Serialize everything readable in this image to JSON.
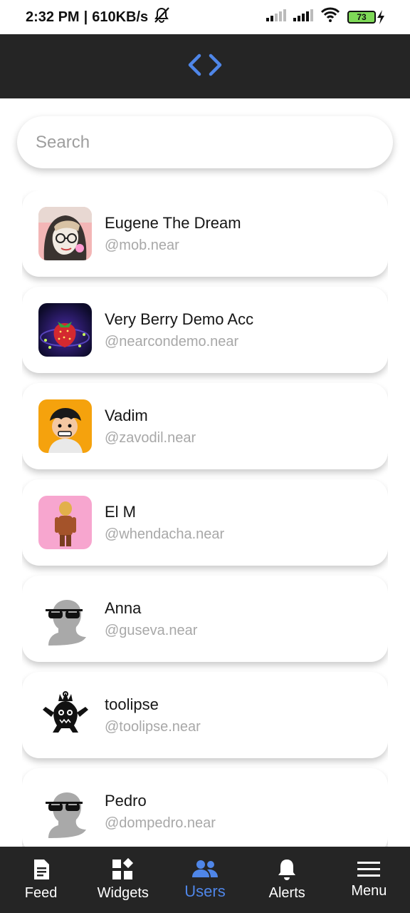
{
  "status_bar": {
    "time": "2:32 PM",
    "separator": "|",
    "speed": "610KB/s",
    "battery": "73"
  },
  "header": {
    "icon": "code-brackets-icon",
    "accent": "#4f86e8"
  },
  "search": {
    "placeholder": "Search",
    "value": ""
  },
  "users": [
    {
      "name": "Eugene The Dream",
      "handle": "@mob.near",
      "avatar": "anime-character-avatar"
    },
    {
      "name": "Very Berry Demo Acc",
      "handle": "@nearcondemo.near",
      "avatar": "strawberry-avatar"
    },
    {
      "name": "Vadim",
      "handle": "@zavodil.near",
      "avatar": "cartoon-face-avatar"
    },
    {
      "name": "El M",
      "handle": "@whendacha.near",
      "avatar": "3d-figure-avatar"
    },
    {
      "name": "Anna",
      "handle": "@guseva.near",
      "avatar": "default-silhouette-avatar"
    },
    {
      "name": "toolipse",
      "handle": "@toolipse.near",
      "avatar": "black-monster-avatar"
    },
    {
      "name": "Pedro",
      "handle": "@dompedro.near",
      "avatar": "default-silhouette-avatar"
    }
  ],
  "tabs": [
    {
      "label": "Feed",
      "icon": "document-icon",
      "active": false
    },
    {
      "label": "Widgets",
      "icon": "widgets-icon",
      "active": false
    },
    {
      "label": "Users",
      "icon": "users-icon",
      "active": true
    },
    {
      "label": "Alerts",
      "icon": "bell-icon",
      "active": false
    },
    {
      "label": "Menu",
      "icon": "hamburger-menu-icon",
      "active": false
    }
  ],
  "colors": {
    "header_bg": "#252525",
    "tab_active": "#4f86e8",
    "handle_text": "#a8a8a8"
  }
}
